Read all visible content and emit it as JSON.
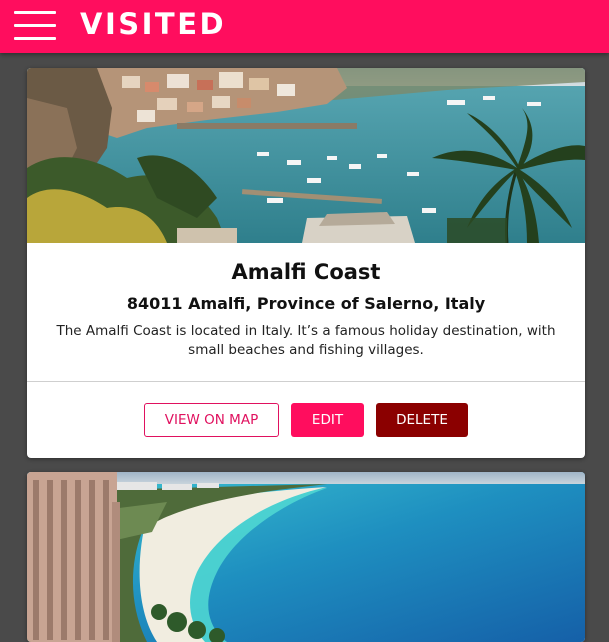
{
  "header": {
    "title": "VISITED",
    "menu_icon": "hamburger-menu-icon",
    "background_color": "#ff0d5e"
  },
  "cards": [
    {
      "title": "Amalfi Coast",
      "address": "84011 Amalfi, Province of Salerno, Italy",
      "description": "The Amalfi Coast is located in Italy. It’s a famous holiday destination, with small beaches and fishing villages.",
      "buttons": {
        "view_on_map": "VIEW ON MAP",
        "edit": "EDIT",
        "delete": "DELETE"
      },
      "image": "amalfi-coast-photo"
    },
    {
      "image": "beach-resort-photo"
    }
  ],
  "colors": {
    "accent": "#ff0d5e",
    "delete": "#8b0000",
    "page_background": "#4a4a4a"
  }
}
